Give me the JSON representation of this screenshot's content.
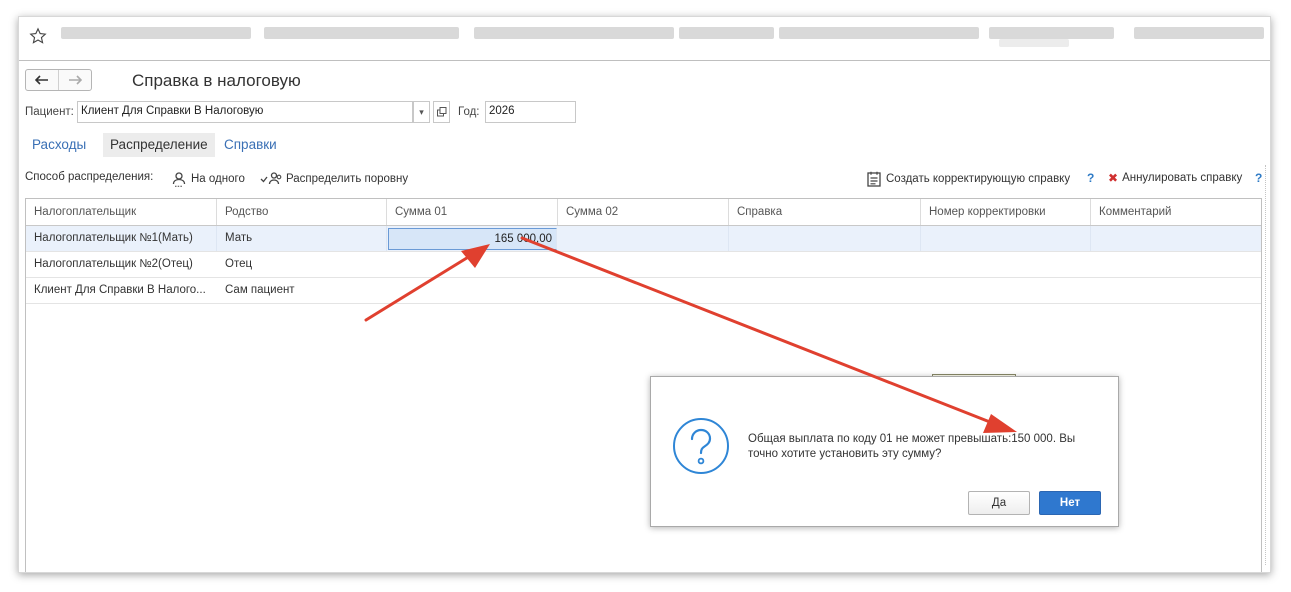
{
  "window": {
    "title": "Справка в налоговую"
  },
  "nav": {
    "back_icon": "arrow-left-icon",
    "forward_icon": "arrow-right-icon"
  },
  "patient_row": {
    "patient_label": "Пациент:",
    "patient_value": "Клиент Для Справки В Налоговую",
    "year_label": "Год:",
    "year_value": "2026"
  },
  "tabs": [
    {
      "label": "Расходы",
      "active": false
    },
    {
      "label": "Распределение",
      "active": true
    },
    {
      "label": "Справки",
      "active": false
    }
  ],
  "toolbar": {
    "method_label": "Способ распределения:",
    "to_one": "На одного",
    "distribute_evenly": "Распределить поровну",
    "create_correction": "Создать корректирующую справку",
    "cancel_cert": "Аннулировать справку",
    "help": "?"
  },
  "table": {
    "columns": [
      "Налогоплательщик",
      "Родство",
      "Сумма 01",
      "Сумма 02",
      "Справка",
      "Номер корректировки",
      "Комментарий"
    ],
    "rows": [
      [
        "Налогоплательщик №1(Мать)",
        "Мать",
        "165 000,00",
        "",
        "",
        "",
        ""
      ],
      [
        "Налогоплательщик №2(Отец)",
        "Отец",
        "",
        "",
        "",
        "",
        ""
      ],
      [
        "Клиент Для Справки В Налого...",
        "Сам пациент",
        "",
        "",
        "",
        "",
        ""
      ]
    ]
  },
  "dialog": {
    "message": "Общая выплата по коду 01 не может превышать:150 000. Вы точно хотите установить эту сумму?",
    "yes": "Да",
    "no": "Нет"
  },
  "colors": {
    "accent": "#2f78cf",
    "link": "#3a70b5",
    "annotation_arrow": "#e0402f",
    "selected_row": "#eaf1fb"
  }
}
